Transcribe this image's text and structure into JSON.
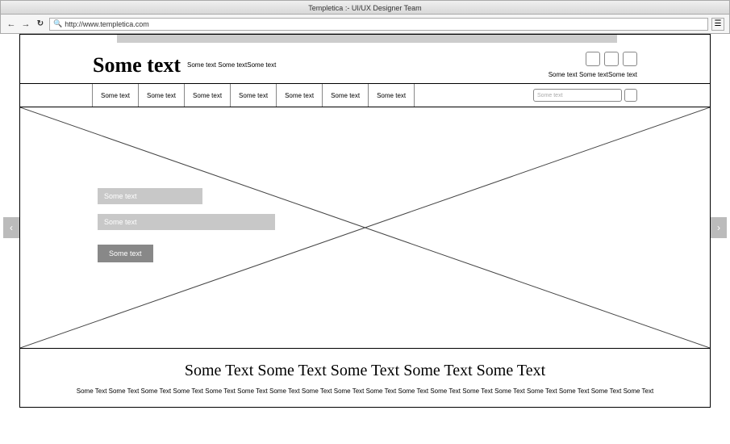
{
  "window": {
    "title": "Templetica :- UI/UX Designer Team"
  },
  "browser": {
    "url": "http://www.templetica.com"
  },
  "header": {
    "logo": "Some text",
    "tagline": "Some text Some textSome text",
    "social_caption": "Some text Some textSome text"
  },
  "nav": {
    "items": [
      {
        "label": "Some text"
      },
      {
        "label": "Some text"
      },
      {
        "label": "Some text"
      },
      {
        "label": "Some text"
      },
      {
        "label": "Some text"
      },
      {
        "label": "Some text"
      },
      {
        "label": "Some text"
      }
    ],
    "search_placeholder": "Some text"
  },
  "hero": {
    "line1": "Some text",
    "line2": "Some text",
    "cta": "Some text"
  },
  "section": {
    "heading": "Some Text Some Text Some Text Some Text Some Text",
    "sub": "Some Text Some Text Some Text Some Text Some Text Some Text Some Text Some Text Some Text Some Text Some Text Some Text Some Text Some Text Some Text Some Text Some Text Some Text"
  }
}
